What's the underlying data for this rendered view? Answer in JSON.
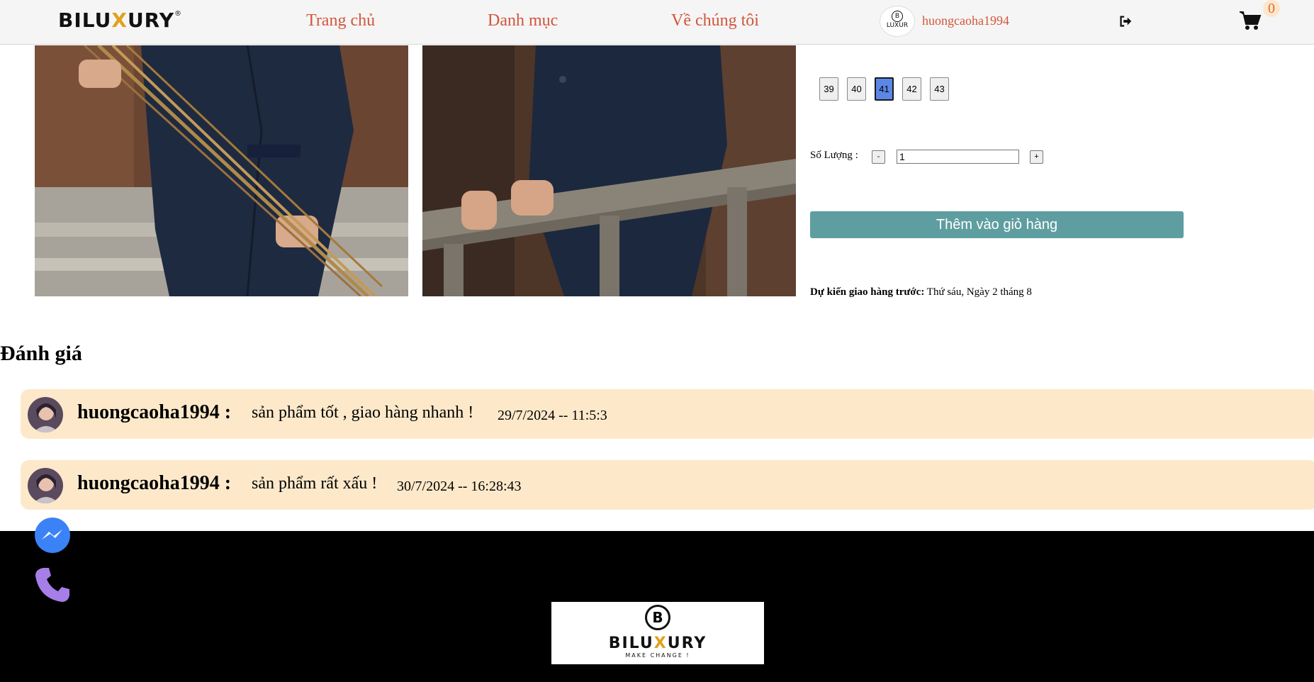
{
  "header": {
    "logo": {
      "part1": "BILU",
      "x": "X",
      "part2": "URY",
      "mark": "®"
    },
    "nav": [
      "Trang chủ",
      "Danh mục",
      "Về chúng tôi"
    ],
    "avatar_text": {
      "b": "B",
      "name": "LUXUR"
    },
    "username": "huongcaoha1994",
    "cart_count": "0"
  },
  "product": {
    "sizes": [
      "39",
      "40",
      "41",
      "42",
      "43"
    ],
    "selected_size": "41",
    "quantity_label": "Số Lượng :",
    "minus_label": "-",
    "plus_label": "+",
    "quantity_value": "1",
    "add_to_cart_label": "Thêm vào giỏ hàng",
    "delivery_label": "Dự kiến giao hàng trước:",
    "delivery_value": "Thứ sáu, Ngày 2 tháng 8"
  },
  "reviews": {
    "title": "Đánh giá",
    "items": [
      {
        "user": "huongcaoha1994 :",
        "text": "sản phẩm tốt , giao hàng nhanh !",
        "date": "29/7/2024 -- 11:5:3"
      },
      {
        "user": "huongcaoha1994 :",
        "text": "sản phẩm rất xấu !",
        "date": "30/7/2024 -- 16:28:43"
      }
    ]
  },
  "footer": {
    "logo_b": "B",
    "logo_name": {
      "part1": "BILU",
      "x": "X",
      "part2": "URY"
    },
    "logo_tag": "MAKE CHANGE !"
  },
  "colors": {
    "nav_link": "#d2553b",
    "add_to_cart_bg": "#5f9ea0",
    "selected_size_bg": "#5b87e6",
    "review_bg": "#fde9ca",
    "messenger": "#3b82f6",
    "phone": "#a67ee8"
  }
}
